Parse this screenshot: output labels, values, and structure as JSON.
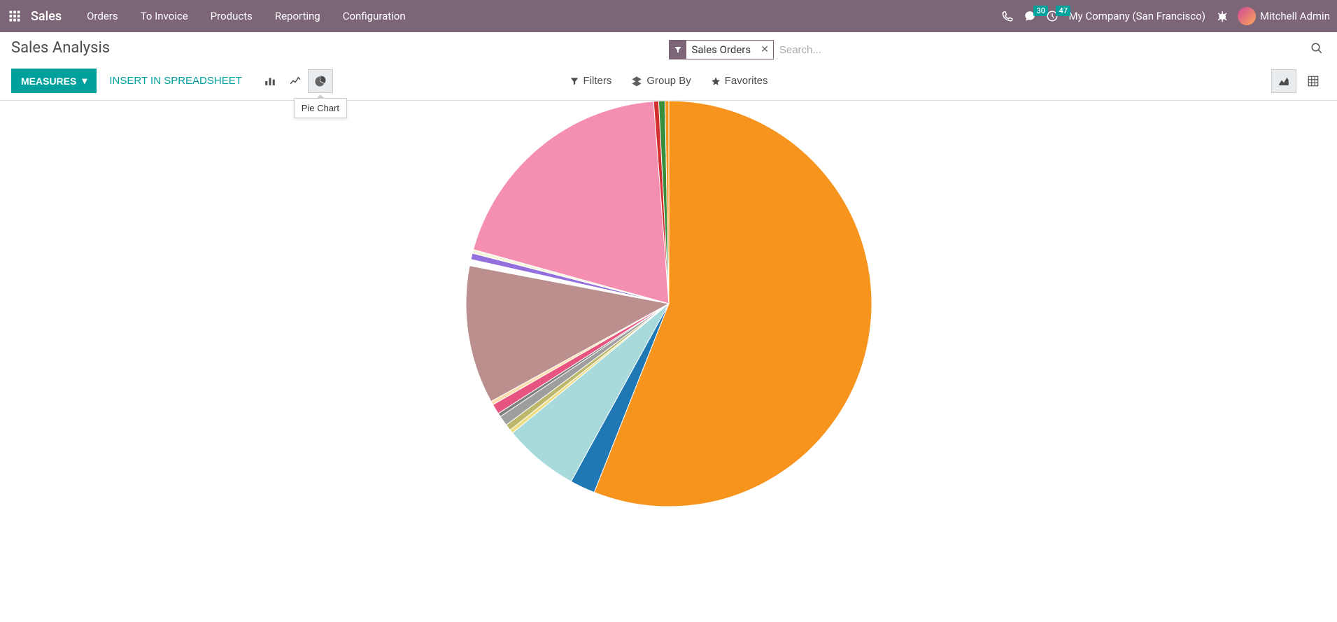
{
  "navbar": {
    "brand": "Sales",
    "links": [
      "Orders",
      "To Invoice",
      "Products",
      "Reporting",
      "Configuration"
    ],
    "messages_badge": "30",
    "activities_badge": "47",
    "company": "My Company (San Francisco)",
    "user": "Mitchell Admin"
  },
  "page_title": "Sales Analysis",
  "search": {
    "facet_label": "Sales Orders",
    "placeholder": "Search..."
  },
  "toolbar": {
    "measures_label": "MEASURES",
    "insert_label": "INSERT IN SPREADSHEET",
    "tooltip": "Pie Chart",
    "filters_label": "Filters",
    "groupby_label": "Group By",
    "favorites_label": "Favorites"
  },
  "chart_data": {
    "type": "pie",
    "title": "",
    "slices": [
      {
        "color": "#F7941D",
        "value": 56.0
      },
      {
        "color": "#1F77B4",
        "value": 2.0
      },
      {
        "color": "#A8DADC",
        "value": 6.0
      },
      {
        "color": "#EEDC82",
        "value": 0.3
      },
      {
        "color": "#BDB76B",
        "value": 0.5
      },
      {
        "color": "#9E9E9E",
        "value": 0.8
      },
      {
        "color": "#808080",
        "value": 0.3
      },
      {
        "color": "#E75480",
        "value": 0.8
      },
      {
        "color": "#FFDEAD",
        "value": 0.3
      },
      {
        "color": "#BC8F8F",
        "value": 11.0
      },
      {
        "color": "#FFFFFF",
        "value": 0.5
      },
      {
        "color": "#9370DB",
        "value": 0.5
      },
      {
        "color": "#F5F5DC",
        "value": 0.3
      },
      {
        "color": "#F48FB1",
        "value": 19.5
      },
      {
        "color": "#D32F2F",
        "value": 0.4
      },
      {
        "color": "#388E3C",
        "value": 0.5
      },
      {
        "color": "#F7941D",
        "value": 0.3
      }
    ]
  }
}
